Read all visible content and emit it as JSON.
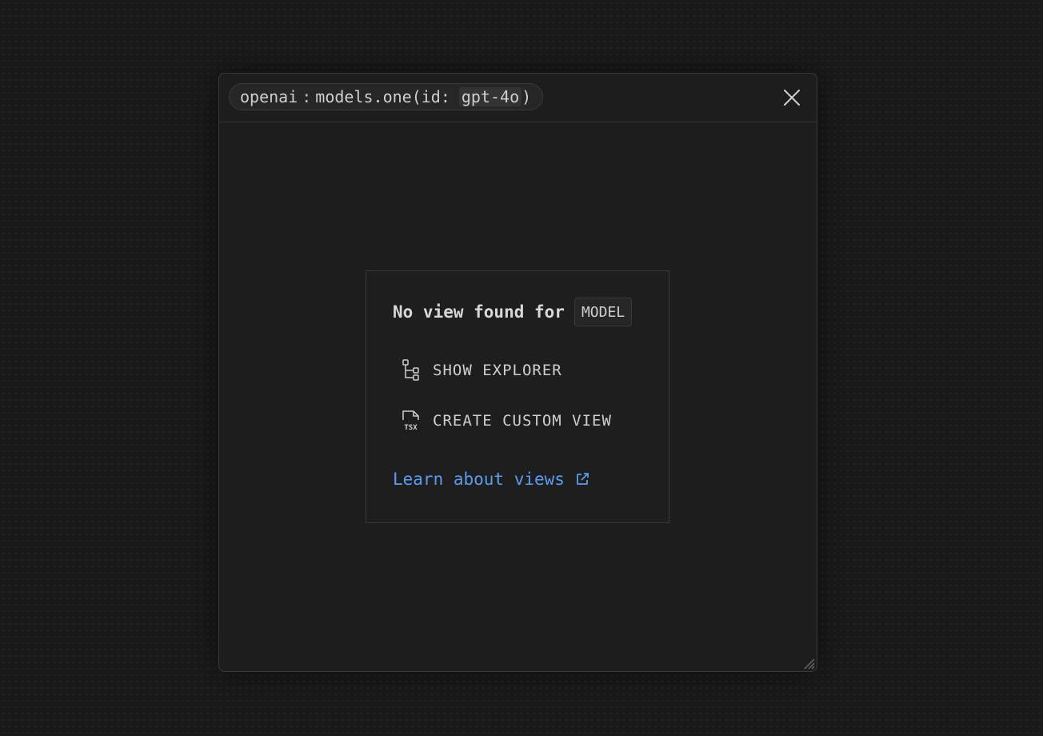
{
  "query": {
    "namespace": "openai",
    "separator": ":",
    "call": "models.one(id:",
    "arg": "gpt-4o",
    "close_paren": ")"
  },
  "card": {
    "title": "No view found for",
    "badge": "MODEL",
    "actions": [
      {
        "label": "SHOW EXPLORER",
        "icon": "tree-icon"
      },
      {
        "label": "CREATE CUSTOM VIEW",
        "icon": "tsx-file-icon"
      }
    ],
    "learn_link": "Learn about views",
    "learn_icon": "external-link-icon",
    "tsx_icon_text": "TSX"
  },
  "colors": {
    "background": "#1a1a1a",
    "panel": "#1d1d1d",
    "link": "#5b9cf0",
    "text": "#cfcfcf"
  }
}
